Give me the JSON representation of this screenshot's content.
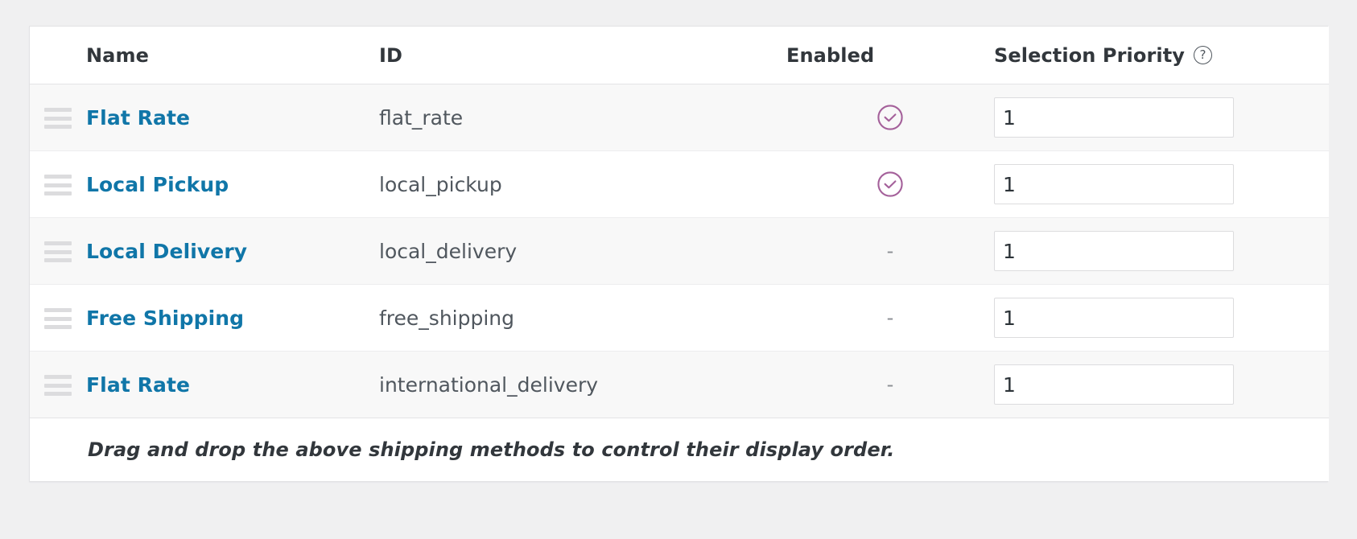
{
  "table": {
    "columns": {
      "handle": "",
      "name": "Name",
      "id": "ID",
      "enabled": "Enabled",
      "priority": "Selection Priority",
      "priority_help_icon": "help-circle-icon",
      "priority_help_glyph": "?"
    },
    "rows": [
      {
        "handle_icon": "drag-handle-icon",
        "name": "Flat Rate",
        "id": "flat_rate",
        "enabled": true,
        "enabled_icon": "check-circle-icon",
        "enabled_dash": "-",
        "priority": "1"
      },
      {
        "handle_icon": "drag-handle-icon",
        "name": "Local Pickup",
        "id": "local_pickup",
        "enabled": true,
        "enabled_icon": "check-circle-icon",
        "enabled_dash": "-",
        "priority": "1"
      },
      {
        "handle_icon": "drag-handle-icon",
        "name": "Local Delivery",
        "id": "local_delivery",
        "enabled": false,
        "enabled_icon": "check-circle-icon",
        "enabled_dash": "-",
        "priority": "1"
      },
      {
        "handle_icon": "drag-handle-icon",
        "name": "Free Shipping",
        "id": "free_shipping",
        "enabled": false,
        "enabled_icon": "check-circle-icon",
        "enabled_dash": "-",
        "priority": "1"
      },
      {
        "handle_icon": "drag-handle-icon",
        "name": "Flat Rate",
        "id": "international_delivery",
        "enabled": false,
        "enabled_icon": "check-circle-icon",
        "enabled_dash": "-",
        "priority": "1"
      }
    ],
    "footer_note": "Drag and drop the above shipping methods to control their display order."
  },
  "colors": {
    "page_background": "#f0f0f1",
    "card_background": "#ffffff",
    "alt_row_background": "#f8f8f8",
    "border": "#e2e2e4",
    "link": "#1076a8",
    "heading_text": "#32373c",
    "body_text": "#50575e",
    "enabled_check": "#a4609a",
    "drag_handle": "#dcdcde",
    "input_border": "#dcdcde"
  }
}
